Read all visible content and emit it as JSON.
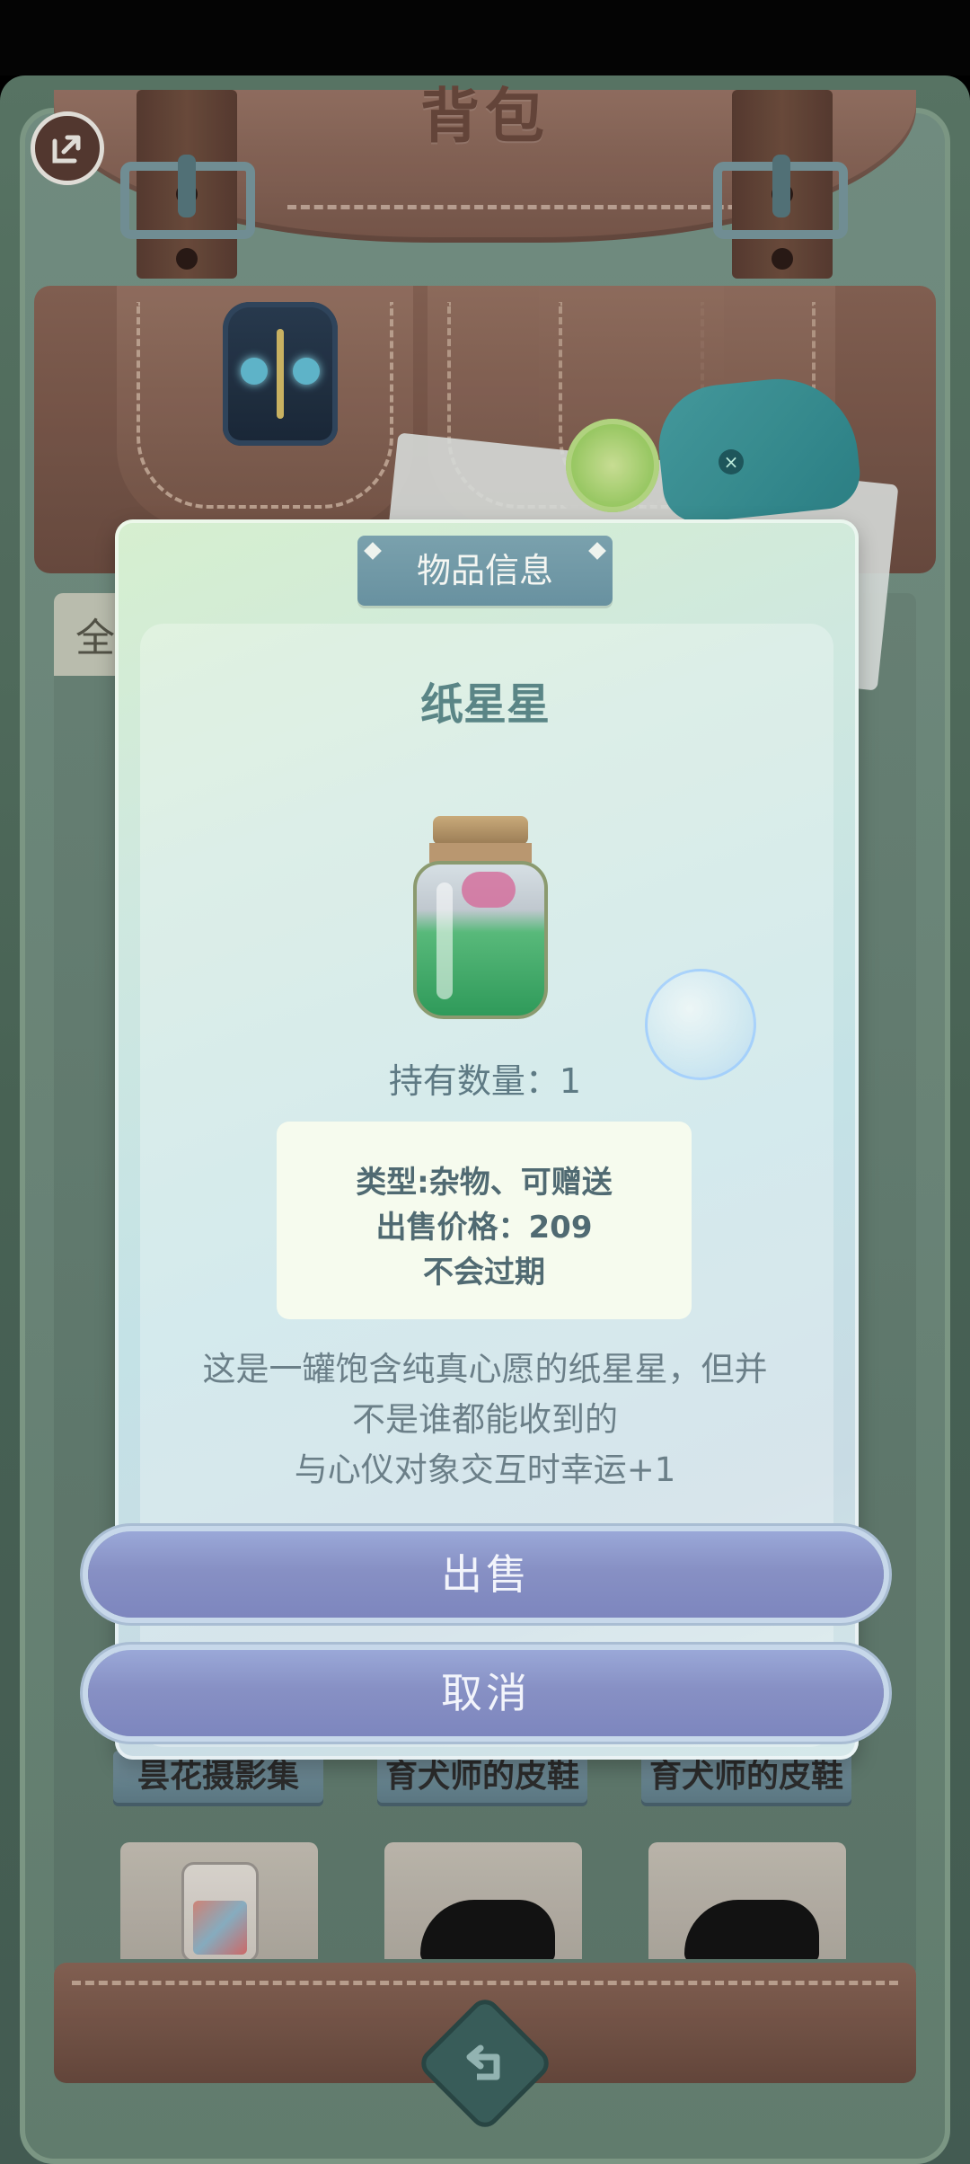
{
  "header": {
    "title": "背包"
  },
  "inventory": {
    "tab_label": "全",
    "items": [
      {
        "label": "昙花摄影集"
      },
      {
        "label": "育犬师的皮鞋"
      },
      {
        "label": "育犬师的皮鞋"
      }
    ]
  },
  "modal": {
    "header": "物品信息",
    "item_name": "纸星星",
    "quantity": "持有数量：1",
    "info": {
      "type": "类型:杂物、可赠送",
      "price": "出售价格：209",
      "expiry": "不会过期"
    },
    "description": [
      "这是一罐饱含纯真心愿的纸星星，但并",
      "不是谁都能收到的",
      "与心仪对象交互时幸运+1"
    ],
    "sell_label": "出售",
    "cancel_label": "取消"
  },
  "colors": {
    "accent": "#6891a0",
    "button": "#8790c4",
    "bag": "#7d5b4e"
  },
  "icons": {
    "exit": "exit-icon",
    "back": "return-arrow-icon"
  }
}
